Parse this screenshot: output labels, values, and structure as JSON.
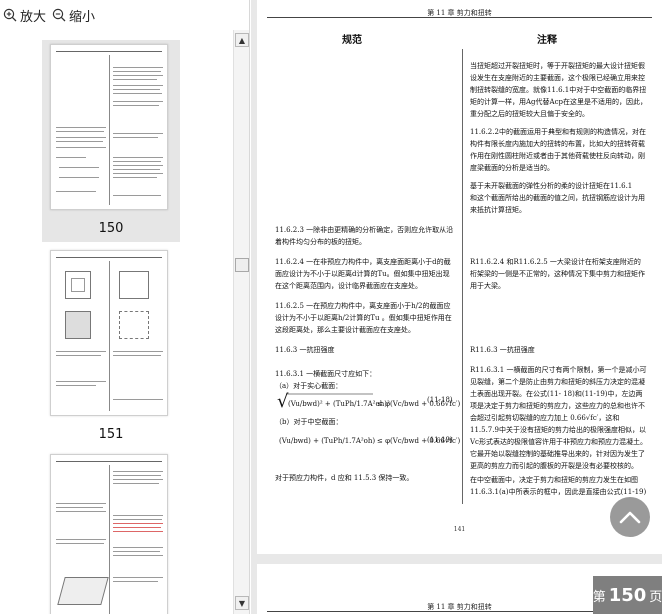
{
  "toolbar": {
    "zoom_in": "放大",
    "zoom_out": "缩小"
  },
  "thumbnails": [
    {
      "label": "150"
    },
    {
      "label": "151"
    },
    {
      "label": ""
    }
  ],
  "page": {
    "header": "第 11 章   剪力和扭转",
    "col_left": "规范",
    "col_right": "注释",
    "right_p1": [
      "当扭矩超过开裂扭矩时，等于开裂扭矩的最大设计扭矩假",
      "设发生在支座附近的主要截面，这个极限已经确立用来控",
      "制扭转裂缝的宽度。就像11.6.1中对于中空截面的临界扭",
      "矩的计算一样，用Ag代替Acp在这里是不适用的，因此，",
      "重分配之后的扭矩较大且偏于安全的。"
    ],
    "right_p2": [
      "11.6.2.2中的截面运用于典型和有规则的构造情况，对在",
      "构件有限长度内施加大的扭转的布置，比如大的扭转荷载",
      "作用在刚性圆柱附近或者由于其他荷载使柱反向转动，刚",
      "度梁截面的分析是适当的。"
    ],
    "right_p3": [
      "基于未开裂截面的弹性分析的柔的设计扭矩在11.6.1",
      "和这个截面所给出的截面的值之间，抗扭钢筋应设计为用",
      "来抵抗计算扭矩。"
    ],
    "left_1162_3": [
      "11.6.2.3  一除非由更精确的分析确定，否则应允许取从沿",
      "着构件均匀分布的板的扭矩。"
    ],
    "left_1162_4": [
      "11.6.2.4  一在非预应力构件中，离支座面距离小于d的截",
      "面应设计为不小于以距离d计算的Tu。假如集中扭矩出现",
      "在这个距离范围内，设计临界截面应在支座处。"
    ],
    "left_1162_5": [
      "11.6.2.5  一在预应力构件中，离支座面小于h/2的截面应",
      "设计为不小于以距离h/2计算的Tu 。假如集中扭矩作用在",
      "这段距离处，那么主要设计截面应在支座处。"
    ],
    "right_r1162": [
      "R11.6.2.4 和R11.6.2.5 一大梁设计在桁架支座附近的",
      "桁架梁的一侧是不正常的，这种情况下集中剪力和扭矩作",
      "用于大梁。"
    ],
    "left_1163": "11.6.3  一抗扭强度",
    "right_r1163": "R11.6.3  一抗扭强度",
    "left_11631": [
      "11.6.3.1  一横截面尺寸应如下：",
      "（a）对于实心截面："
    ],
    "left_hollow": "（b）对于中空截面：",
    "eq1_num": "(11-18)",
    "eq2_num": "(11-19)",
    "eq_rhs": "≤ φ(Vc/bwd + 0.66√fc′)",
    "left_end": "对于预应力构件，d 应和 11.5.3 保持一致。",
    "right_r11631": [
      "R11.6.3.1 一横截面的尺寸有两个限制，第一个是减小可",
      "见裂缝，第二个是防止由剪力和扭矩的斜压力决定的混凝",
      "土表面出现开裂。在公式(11- 18)和(11-19)中，左边两",
      "项是决定于剪力和扭矩的剪应力，这些应力的总和也许不",
      "会超过引起剪切裂缝的应力加上 0.66√fc′，这和",
      "11.5.7.9中关于没有扭矩的剪力给出的极限强度相似，以",
      "Vc形式表达的极限值容许用于非预应力和预应力混凝土。",
      "它最开始以裂缝控制的基础推导出来的，针对因为发生了",
      "更高的剪应力而引起的腹板的开裂是没有必要校核的。"
    ],
    "right_last": [
      "在中空截面中，决定于剪力和扭矩的剪应力发生在如图",
      "11.6.3.1(a)中所表示的框中，因此是直接由公式(11-19)"
    ],
    "footer_num": "141"
  },
  "page2": {
    "header": "第 11 章   剪力和扭转"
  },
  "badge": {
    "prefix": "第",
    "number": "150",
    "suffix": "页"
  },
  "colors": {
    "badge_bg": "#7f7f7f",
    "up_button_bg": "#9a9a9a",
    "selected_thumb_bg": "#e6e6e6"
  }
}
